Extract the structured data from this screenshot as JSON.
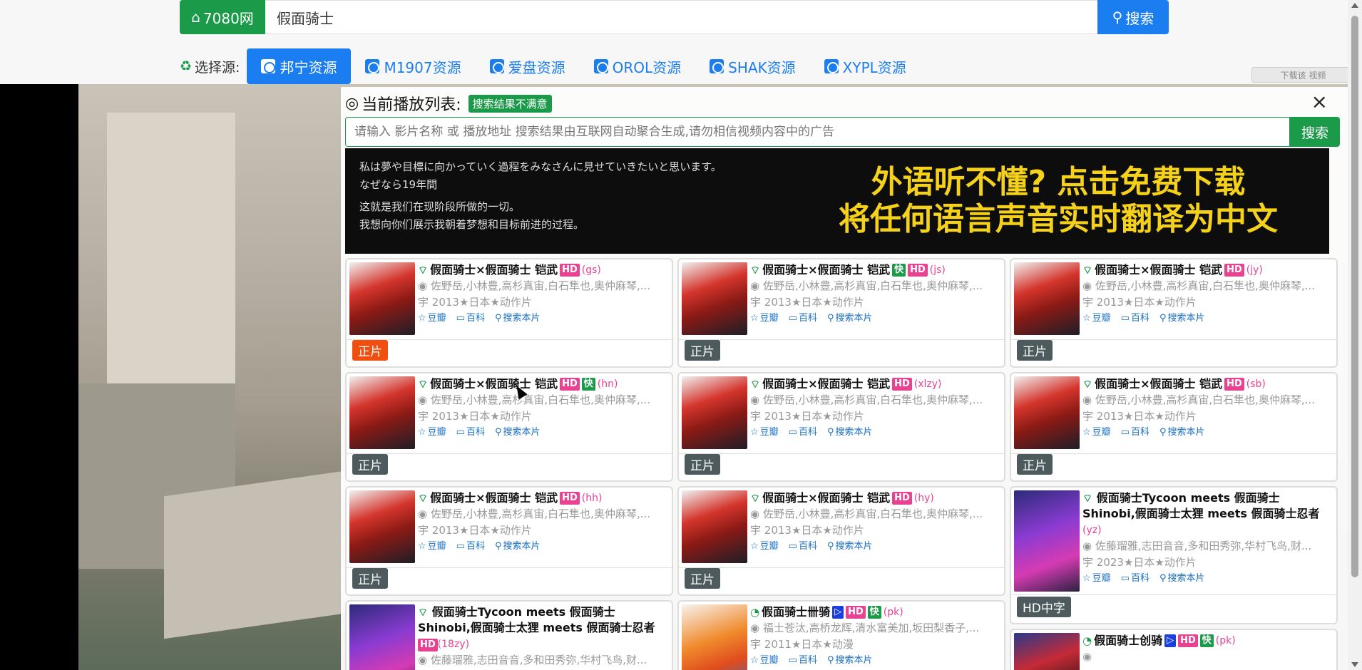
{
  "brand": {
    "label": "7080网"
  },
  "search": {
    "value": "假面骑士",
    "button": "搜索"
  },
  "sources": {
    "label": "选择源:",
    "tabs": [
      "邦宁资源",
      "M1907资源",
      "爱盘资源",
      "OROL资源",
      "SHAK资源",
      "XYPL资源"
    ],
    "active": "邦宁资源"
  },
  "download_badge": "下载该 视频",
  "panel": {
    "title": "当前播放列表:",
    "badge": "搜索结果不满意",
    "close": "×",
    "search_placeholder": "请输入 影片名称 或 播放地址 搜索结果由互联网自动聚合生成,请勿相信视频内容中的广告",
    "search_button": "搜索"
  },
  "ad": {
    "line1": "私は夢や目標に向かっていく過程をみなさんに見せていきたいと思います。",
    "line2": "なぜなら19年間",
    "line3": "这就是我们在现阶段所做的一切。",
    "line4": "我想向你们展示我朝着梦想和目标前进的过程。",
    "headline1": "外语听不懂? 点击免费下载",
    "headline2": "将任何语言声音实时翻译为中文"
  },
  "link_labels": {
    "douban": "豆瓣",
    "baike": "百科",
    "search": "搜索本片"
  },
  "cards": [
    {
      "title": "假面骑士×假面骑士 铠武",
      "tags": [
        "HD"
      ],
      "code": "(gs)",
      "cast": "佐野岳,小林豊,高杉真宙,白石隼也,奥仲麻琴,...",
      "year": "2013★日本★动作片",
      "status": "正片"
    },
    {
      "title": "假面骑士×假面骑士 铠武",
      "tags": [
        "快",
        "HD"
      ],
      "code": "(js)",
      "cast": "佐野岳,小林豊,高杉真宙,白石隼也,奥仲麻琴,...",
      "year": "2013★日本★动作片",
      "status": "正片"
    },
    {
      "title": "假面骑士×假面骑士 铠武",
      "tags": [
        "HD"
      ],
      "code": "(jy)",
      "cast": "佐野岳,小林豊,高杉真宙,白石隼也,奥仲麻琴,...",
      "year": "2013★日本★动作片",
      "status": "正片"
    },
    {
      "title": "假面骑士×假面骑士 铠武",
      "tags": [
        "HD",
        "快"
      ],
      "code": "(hn)",
      "cast": "佐野岳,小林豊,高杉真宙,白石隼也,奥仲麻琴,...",
      "year": "2013★日本★动作片",
      "status": "正片"
    },
    {
      "title": "假面骑士×假面骑士 铠武",
      "tags": [
        "HD"
      ],
      "code": "(xlzy)",
      "cast": "佐野岳,小林豊,高杉真宙,白石隼也,奥仲麻琴,...",
      "year": "2013★日本★动作片",
      "status": "正片"
    },
    {
      "title": "假面骑士×假面骑士 铠武",
      "tags": [
        "HD"
      ],
      "code": "(sb)",
      "cast": "佐野岳,小林豊,高杉真宙,白石隼也,奥仲麻琴,...",
      "year": "2013★日本★动作片",
      "status": "正片"
    },
    {
      "title": "假面骑士×假面骑士 铠武",
      "tags": [
        "HD"
      ],
      "code": "(hh)",
      "cast": "佐野岳,小林豊,高杉真宙,白石隼也,奥仲麻琴,...",
      "year": "2013★日本★动作片",
      "status": "正片"
    },
    {
      "title": "假面骑士×假面骑士 铠武",
      "tags": [
        "HD"
      ],
      "code": "(hy)",
      "cast": "佐野岳,小林豊,高杉真宙,白石隼也,奥仲麻琴,...",
      "year": "2013★日本★动作片",
      "status": "正片"
    },
    {
      "title": "假面骑士Tycoon meets 假面骑士Shinobi,假面骑士太狸 meets 假面骑士忍者",
      "tags": [],
      "code": "(yz)",
      "cast": "佐藤瑠雅,志田音音,多和田秀弥,华村飞鸟,财...",
      "year": "2023★日本★动作片",
      "status": "HD中字"
    },
    {
      "title": "假面骑士Tycoon meets 假面骑士Shinobi,假面骑士太狸 meets 假面骑士忍者",
      "tags": [
        "HD"
      ],
      "code": "(18zy)",
      "cast": "佐藤瑠雅,志田音音,多和田秀弥,华村飞鸟,财...",
      "year": "",
      "status": ""
    },
    {
      "title": "假面骑士卌骑",
      "tags": [
        "▷",
        "HD",
        "快"
      ],
      "code": "(pk)",
      "cast": "福士苍汰,高桥龙辉,清水富美加,坂田梨香子,...",
      "year": "2011★日本★动漫",
      "status": ""
    },
    {
      "title": "假面骑士创骑",
      "tags": [
        "▷",
        "HD",
        "快"
      ],
      "code": "(pk)",
      "cast": "",
      "year": "",
      "status": ""
    }
  ]
}
